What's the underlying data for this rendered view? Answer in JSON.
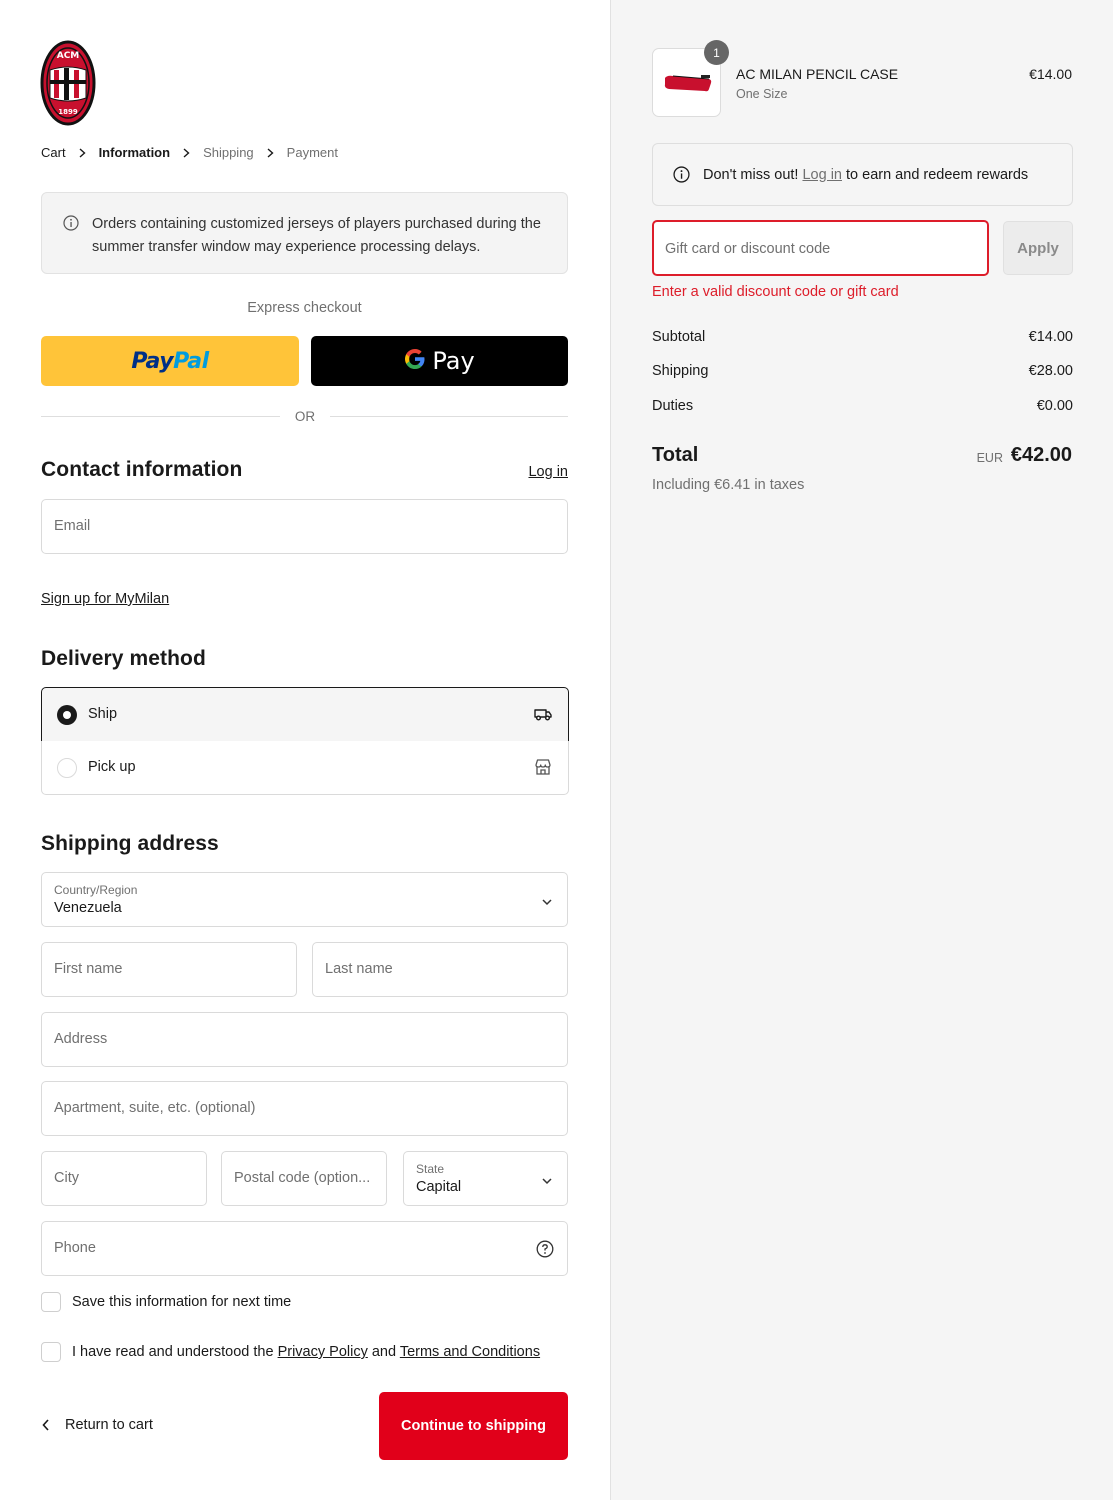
{
  "brand": {
    "logo_text": "ACM",
    "logo_year": "1899",
    "primary_color": "#e1001a"
  },
  "breadcrumb": [
    {
      "label": "Cart"
    },
    {
      "label": "Information"
    },
    {
      "label": "Shipping"
    },
    {
      "label": "Payment"
    }
  ],
  "notice": "Orders containing customized jerseys of players purchased during the summer transfer window may experience processing delays.",
  "express": {
    "label": "Express checkout",
    "paypal_a": "Pay",
    "paypal_b": "Pal",
    "gpay": "Pay",
    "or": "OR"
  },
  "contact": {
    "title": "Contact information",
    "login": "Log in",
    "email_placeholder": "Email",
    "signup": "Sign up for MyMilan"
  },
  "delivery": {
    "title": "Delivery method",
    "ship": "Ship",
    "pickup": "Pick up"
  },
  "shipping": {
    "title": "Shipping address",
    "country_label": "Country/Region",
    "country_value": "Venezuela",
    "first_name": "First name",
    "last_name": "Last name",
    "address": "Address",
    "apartment": "Apartment, suite, etc. (optional)",
    "city": "City",
    "postal": "Postal code (option...",
    "state_label": "State",
    "state_value": "Capital",
    "phone": "Phone"
  },
  "save_info": "Save this information for next time",
  "terms": {
    "prefix": "I have read and understood the ",
    "privacy": "Privacy Policy",
    "and": " and ",
    "tc": "Terms and Conditions"
  },
  "actions": {
    "return": "Return to cart",
    "continue": "Continue to shipping"
  },
  "order": {
    "item_name": "AC MILAN PENCIL CASE",
    "item_variant": "One Size",
    "item_price": "€14.00",
    "item_qty": "1",
    "rewards_prefix": "Don't miss out! ",
    "rewards_link": "Log in",
    "rewards_suffix": " to earn and redeem rewards",
    "discount_placeholder": "Gift card or discount code",
    "apply": "Apply",
    "error": "Enter a valid discount code or gift card",
    "subtotal_label": "Subtotal",
    "subtotal": "€14.00",
    "shipping_label": "Shipping",
    "shipping": "€28.00",
    "duties_label": "Duties",
    "duties": "€0.00",
    "total_label": "Total",
    "currency": "EUR",
    "total": "€42.00",
    "taxes": "Including €6.41 in taxes"
  }
}
